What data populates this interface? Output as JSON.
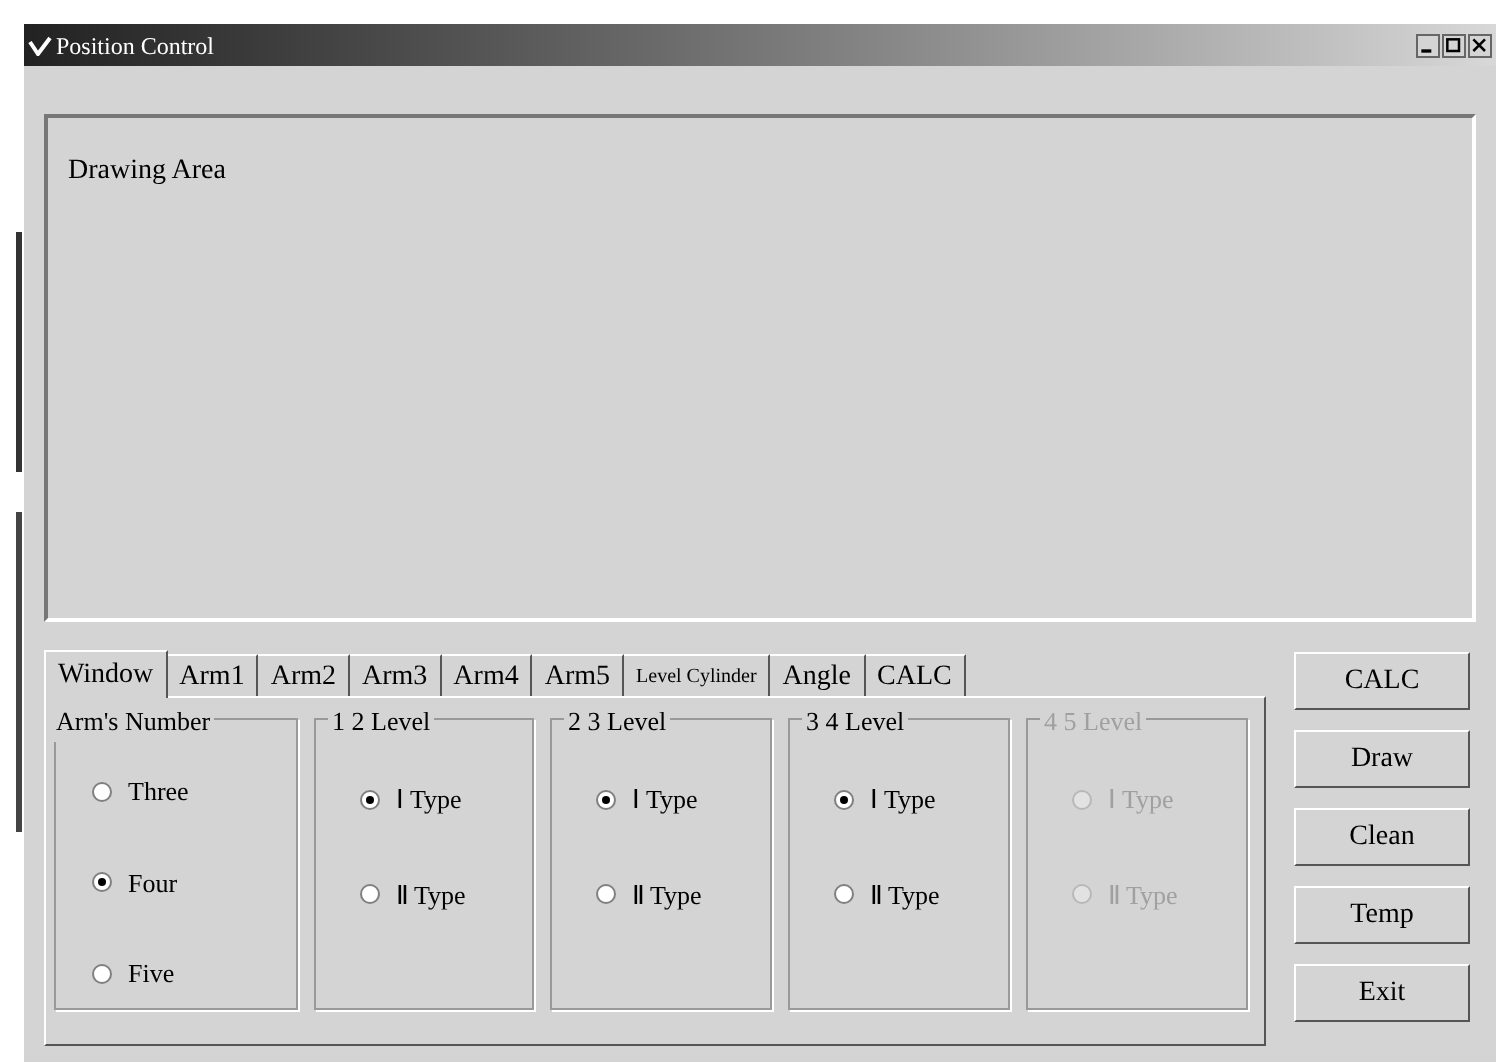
{
  "window": {
    "title": "Position Control"
  },
  "drawing_area": {
    "label": "Drawing Area"
  },
  "tabs": [
    {
      "label": "Window",
      "selected": true
    },
    {
      "label": "Arm1",
      "selected": false
    },
    {
      "label": "Arm2",
      "selected": false
    },
    {
      "label": "Arm3",
      "selected": false
    },
    {
      "label": "Arm4",
      "selected": false
    },
    {
      "label": "Arm5",
      "selected": false
    },
    {
      "label": "Level Cylinder",
      "selected": false
    },
    {
      "label": "Angle",
      "selected": false
    },
    {
      "label": "CALC",
      "selected": false
    }
  ],
  "groups": [
    {
      "title": "Arm's Number",
      "disabled": false,
      "options": [
        {
          "label": "Three",
          "selected": false
        },
        {
          "label": "Four",
          "selected": true
        },
        {
          "label": "Five",
          "selected": false
        }
      ]
    },
    {
      "title": "1 2 Level",
      "disabled": false,
      "options": [
        {
          "label": "Ⅰ Type",
          "selected": true
        },
        {
          "label": "Ⅱ Type",
          "selected": false
        }
      ]
    },
    {
      "title": "2 3 Level",
      "disabled": false,
      "options": [
        {
          "label": "Ⅰ Type",
          "selected": true
        },
        {
          "label": "Ⅱ Type",
          "selected": false
        }
      ]
    },
    {
      "title": "3 4 Level",
      "disabled": false,
      "options": [
        {
          "label": "Ⅰ Type",
          "selected": true
        },
        {
          "label": "Ⅱ Type",
          "selected": false
        }
      ]
    },
    {
      "title": "4 5 Level",
      "disabled": true,
      "options": [
        {
          "label": "Ⅰ Type",
          "selected": false
        },
        {
          "label": "Ⅱ Type",
          "selected": false
        }
      ]
    }
  ],
  "buttons": [
    "CALC",
    "Draw",
    "Clean",
    "Temp",
    "Exit"
  ]
}
